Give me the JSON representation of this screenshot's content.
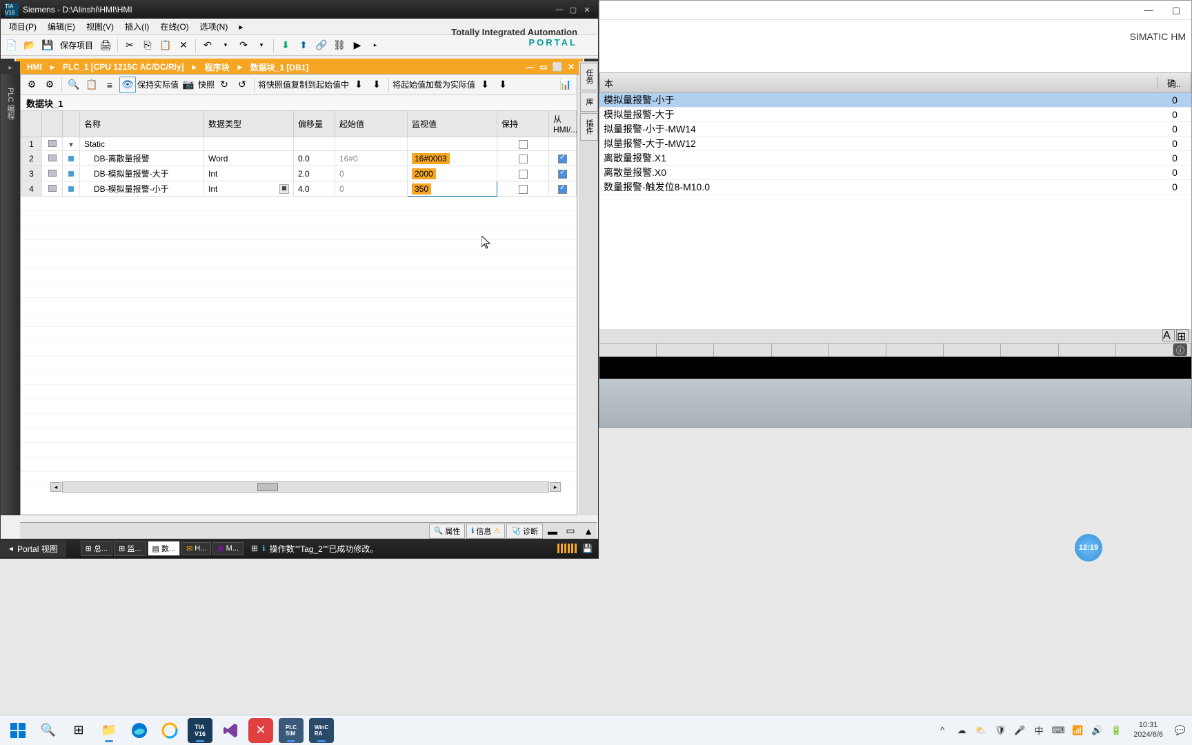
{
  "tia": {
    "logo": "TIA V16",
    "title": "Siemens - D:\\Alinshi\\HMI\\HMI",
    "menu": [
      "项目(P)",
      "编辑(E)",
      "视图(V)",
      "插入(I)",
      "在线(O)",
      "选项(N)"
    ],
    "toolbar": {
      "save": "保存项目"
    },
    "branding": {
      "line1": "Totally Integrated Automation",
      "line2": "PORTAL"
    },
    "breadcrumb": [
      "HMI",
      "PLC_1 [CPU 1215C AC/DC/Rly]",
      "程序块",
      "数据块_1 [DB1]"
    ],
    "left_sidebar": "PLC 编程",
    "right_tabs": [
      "任务",
      "库",
      "插件"
    ],
    "db_editor": {
      "toolbar_labels": {
        "keep_actual": "保持实际值",
        "snapshot": "快照",
        "copy_snapshot": "将快照值复制到起始值中",
        "load_start": "将起始值加载为实际值"
      },
      "block_name": "数据块_1",
      "columns": [
        "名称",
        "数据类型",
        "偏移量",
        "起始值",
        "监视值",
        "保持",
        "从 HMI/..."
      ],
      "rows": [
        {
          "idx": 1,
          "name": "Static",
          "type": "",
          "offset": "",
          "start": "",
          "monitor": "",
          "retain": false,
          "hmi": false,
          "is_group": true
        },
        {
          "idx": 2,
          "name": "DB-离散量报警",
          "type": "Word",
          "offset": "0.0",
          "start": "16#0",
          "monitor": "16#0003",
          "retain": false,
          "hmi": true
        },
        {
          "idx": 3,
          "name": "DB-模拟量报警-大于",
          "type": "Int",
          "offset": "2.0",
          "start": "0",
          "monitor": "2000",
          "retain": false,
          "hmi": true
        },
        {
          "idx": 4,
          "name": "DB-模拟量报警-小于",
          "type": "Int",
          "offset": "4.0",
          "start": "0",
          "monitor": "350",
          "retain": false,
          "hmi": true,
          "active": true
        }
      ]
    },
    "properties_tabs": [
      {
        "icon": "🔍",
        "label": "属性"
      },
      {
        "icon": "ℹ",
        "label": "信息",
        "badge": "⚠"
      },
      {
        "icon": "🩺",
        "label": "诊断"
      }
    ],
    "statusbar": {
      "portal": "Portal 视图",
      "tabs": [
        {
          "icon": "⊞",
          "label": "总..."
        },
        {
          "icon": "⊞",
          "label": "监..."
        },
        {
          "icon": "▤",
          "label": "数..."
        },
        {
          "icon": "✉",
          "label": "H..."
        },
        {
          "icon": "⊞",
          "label": "M..."
        }
      ],
      "message": "操作数\"\"Tag_2\"\"已成功修改。"
    }
  },
  "hmi": {
    "brand": "SIMATIC HM",
    "header": {
      "col1": "本",
      "col2": "确.."
    },
    "alarms": [
      {
        "text": "模拟量报警-小于",
        "val": "0",
        "selected": true
      },
      {
        "text": "模拟量报警-大于",
        "val": "0"
      },
      {
        "text": "拟量报警-小于-MW14",
        "val": "0"
      },
      {
        "text": "拟量报警-大于-MW12",
        "val": "0"
      },
      {
        "text": "离散量报警.X1",
        "val": "0"
      },
      {
        "text": "离散量报警.X0",
        "val": "0"
      },
      {
        "text": "数量报警-触发位8-M10.0",
        "val": "0"
      }
    ]
  },
  "clock_widget": "12:19",
  "taskbar": {
    "time": "10:31",
    "date": "2024/6/6",
    "ime": "中"
  }
}
